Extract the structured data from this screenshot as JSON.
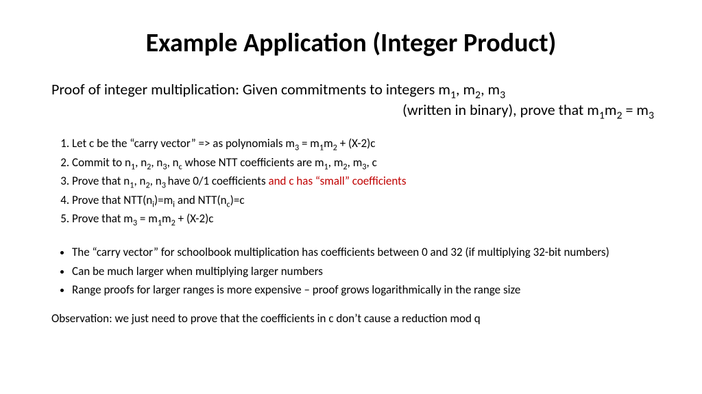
{
  "title": "Example Application (Integer Product)",
  "subtitle": {
    "line1_pre": "Proof of integer multiplication: Given commitments to integers m",
    "line1_s1": "1",
    "line1_mid1": ", m",
    "line1_s2": "2",
    "line1_mid2": ", m",
    "line1_s3": "3",
    "line2_pre": "(written in binary), prove that m",
    "line2_s1": "1",
    "line2_mid": "m",
    "line2_s2": "2",
    "line2_eq": " = m",
    "line2_s3": "3"
  },
  "steps": {
    "s1_a": "Let c be the “carry vector” => as polynomials m",
    "s1_b": "3",
    "s1_c": " = m",
    "s1_d": "1",
    "s1_e": "m",
    "s1_f": "2",
    "s1_g": " + (X-2)c",
    "s2_a": "Commit to n",
    "s2_b": "1",
    "s2_c": ", n",
    "s2_d": "2",
    "s2_e": ", n",
    "s2_f": "3",
    "s2_g": ", n",
    "s2_h": "c",
    "s2_i": " whose NTT coefficients are m",
    "s2_j": "1",
    "s2_k": ", m",
    "s2_l": "2",
    "s2_m": ", m",
    "s2_n": "3",
    "s2_o": ", c",
    "s3_a": "Prove that n",
    "s3_b": "1",
    "s3_c": ", n",
    "s3_d": "2",
    "s3_e": ", n",
    "s3_f": "3 ",
    "s3_g": "have 0/1 coefficients  ",
    "s3_red": "and c has “small” coefficients",
    "s4_a": "Prove that NTT(n",
    "s4_b": "i",
    "s4_c": ")=m",
    "s4_d": "i",
    "s4_e": " and NTT(n",
    "s4_f": "c",
    "s4_g": ")=c",
    "s5_a": "Prove that m",
    "s5_b": "3",
    "s5_c": " = m",
    "s5_d": "1",
    "s5_e": "m",
    "s5_f": "2",
    "s5_g": " + (X-2)c"
  },
  "bullets": {
    "b1": "The “carry vector” for schoolbook multiplication has coefficients between 0 and 32 (if multiplying 32-bit numbers)",
    "b2": "Can be much larger when multiplying larger numbers",
    "b3": "Range proofs for larger ranges is more expensive – proof grows logarithmically in the range size"
  },
  "observation": "Observation: we just need to prove that the coefficients in c don’t cause a reduction mod q"
}
